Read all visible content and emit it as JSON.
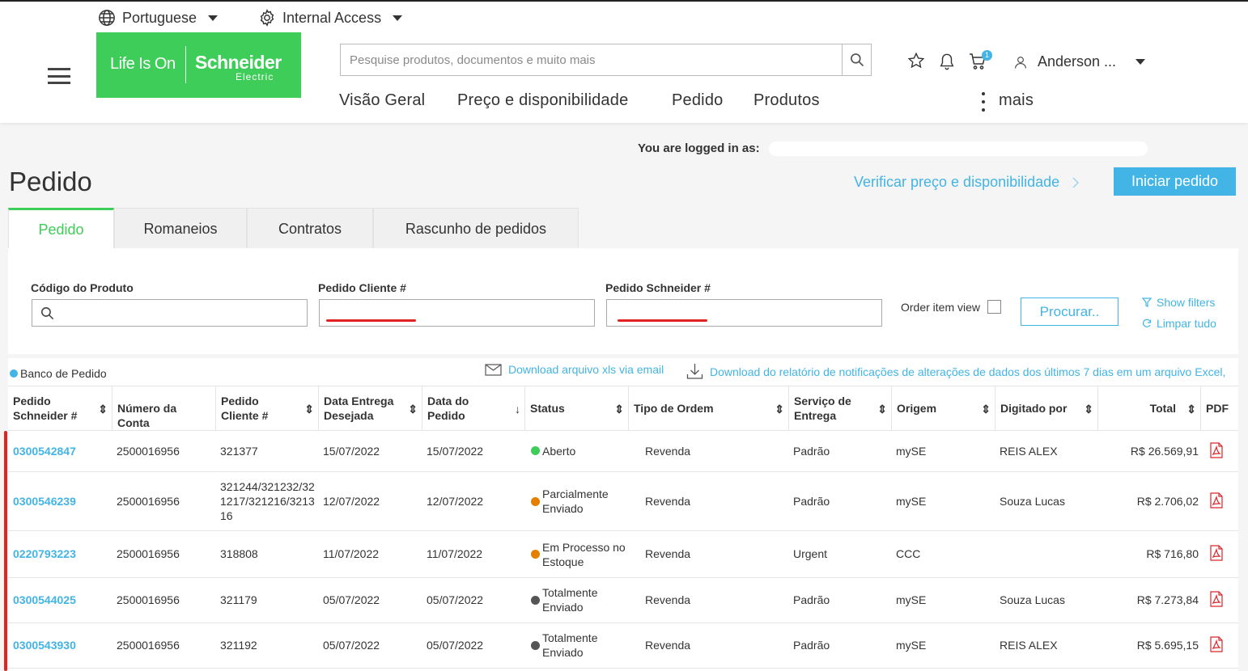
{
  "utility": {
    "language": "Portuguese",
    "access": "Internal Access"
  },
  "brand": {
    "tagline": "Life Is On",
    "name": "Schneider",
    "sub": "Electric",
    "color": "#3dcd58"
  },
  "search": {
    "placeholder": "Pesquise produtos, documentos e muito mais"
  },
  "header": {
    "cart_count": "1",
    "user": "Anderson ..."
  },
  "nav": {
    "items": [
      "Visão Geral",
      "Preço e disponibilidade",
      "Pedido",
      "Produtos"
    ],
    "more": "mais"
  },
  "session": {
    "logged_label": "You are logged in as:"
  },
  "page": {
    "title": "Pedido",
    "verify_link": "Verificar preço e disponibilidade",
    "start_button": "Iniciar pedido"
  },
  "tabs": [
    "Pedido",
    "Romaneios",
    "Contratos",
    "Rascunho de pedidos"
  ],
  "filters": {
    "product_code_label": "Código do Produto",
    "client_order_label": "Pedido Cliente #",
    "schneider_order_label": "Pedido Schneider #",
    "order_item_view": "Order item view",
    "search_button": "Procurar..",
    "show_filters": "Show filters",
    "clear_all": "Limpar tudo"
  },
  "table_tools": {
    "bank_label": "Banco de Pedido",
    "download_xls": "Download arquivo xls via email",
    "download_report": "Download do relatório de notificações de alterações de dados dos últimos 7 dias em um arquivo Excel,"
  },
  "columns": [
    "Pedido Schneider #",
    "Número da Conta",
    "Pedido Cliente #",
    "Data Entrega Desejada",
    "Data do Pedido",
    "Status",
    "Tipo de Ordem",
    "Serviço de Entrega",
    "Origem",
    "Digitado por",
    "Total",
    "PDF"
  ],
  "status_colors": {
    "open": "#3dcd58",
    "progress": "#e47f00",
    "done": "#555555"
  },
  "rows": [
    {
      "order": "0300542847",
      "account": "2500016956",
      "client": "321377",
      "desired": "15/07/2022",
      "date": "15/07/2022",
      "status": "Aberto",
      "status_color": "#3dcd58",
      "type": "Revenda",
      "service": "Padrão",
      "origin": "mySE",
      "by": "REIS ALEX",
      "total": "R$ 26.569,91"
    },
    {
      "order": "0300546239",
      "account": "2500016956",
      "client": "321244/321232/321217/321216/321316",
      "desired": "12/07/2022",
      "date": "12/07/2022",
      "status": "Parcialmente Enviado",
      "status_color": "#e47f00",
      "type": "Revenda",
      "service": "Padrão",
      "origin": "mySE",
      "by": "Souza Lucas",
      "total": "R$ 2.706,02"
    },
    {
      "order": "0220793223",
      "account": "2500016956",
      "client": "318808",
      "desired": "11/07/2022",
      "date": "11/07/2022",
      "status": "Em Processo no Estoque",
      "status_color": "#e47f00",
      "type": "Revenda",
      "service": "Urgent",
      "origin": "CCC",
      "by": "",
      "total": "R$ 716,80"
    },
    {
      "order": "0300544025",
      "account": "2500016956",
      "client": "321179",
      "desired": "05/07/2022",
      "date": "05/07/2022",
      "status": "Totalmente Enviado",
      "status_color": "#555555",
      "type": "Revenda",
      "service": "Padrão",
      "origin": "mySE",
      "by": "Souza Lucas",
      "total": "R$ 7.273,84"
    },
    {
      "order": "0300543930",
      "account": "2500016956",
      "client": "321192",
      "desired": "05/07/2022",
      "date": "05/07/2022",
      "status": "Totalmente Enviado",
      "status_color": "#555555",
      "type": "Revenda",
      "service": "Padrão",
      "origin": "mySE",
      "by": "REIS ALEX",
      "total": "R$ 5.695,15"
    }
  ]
}
